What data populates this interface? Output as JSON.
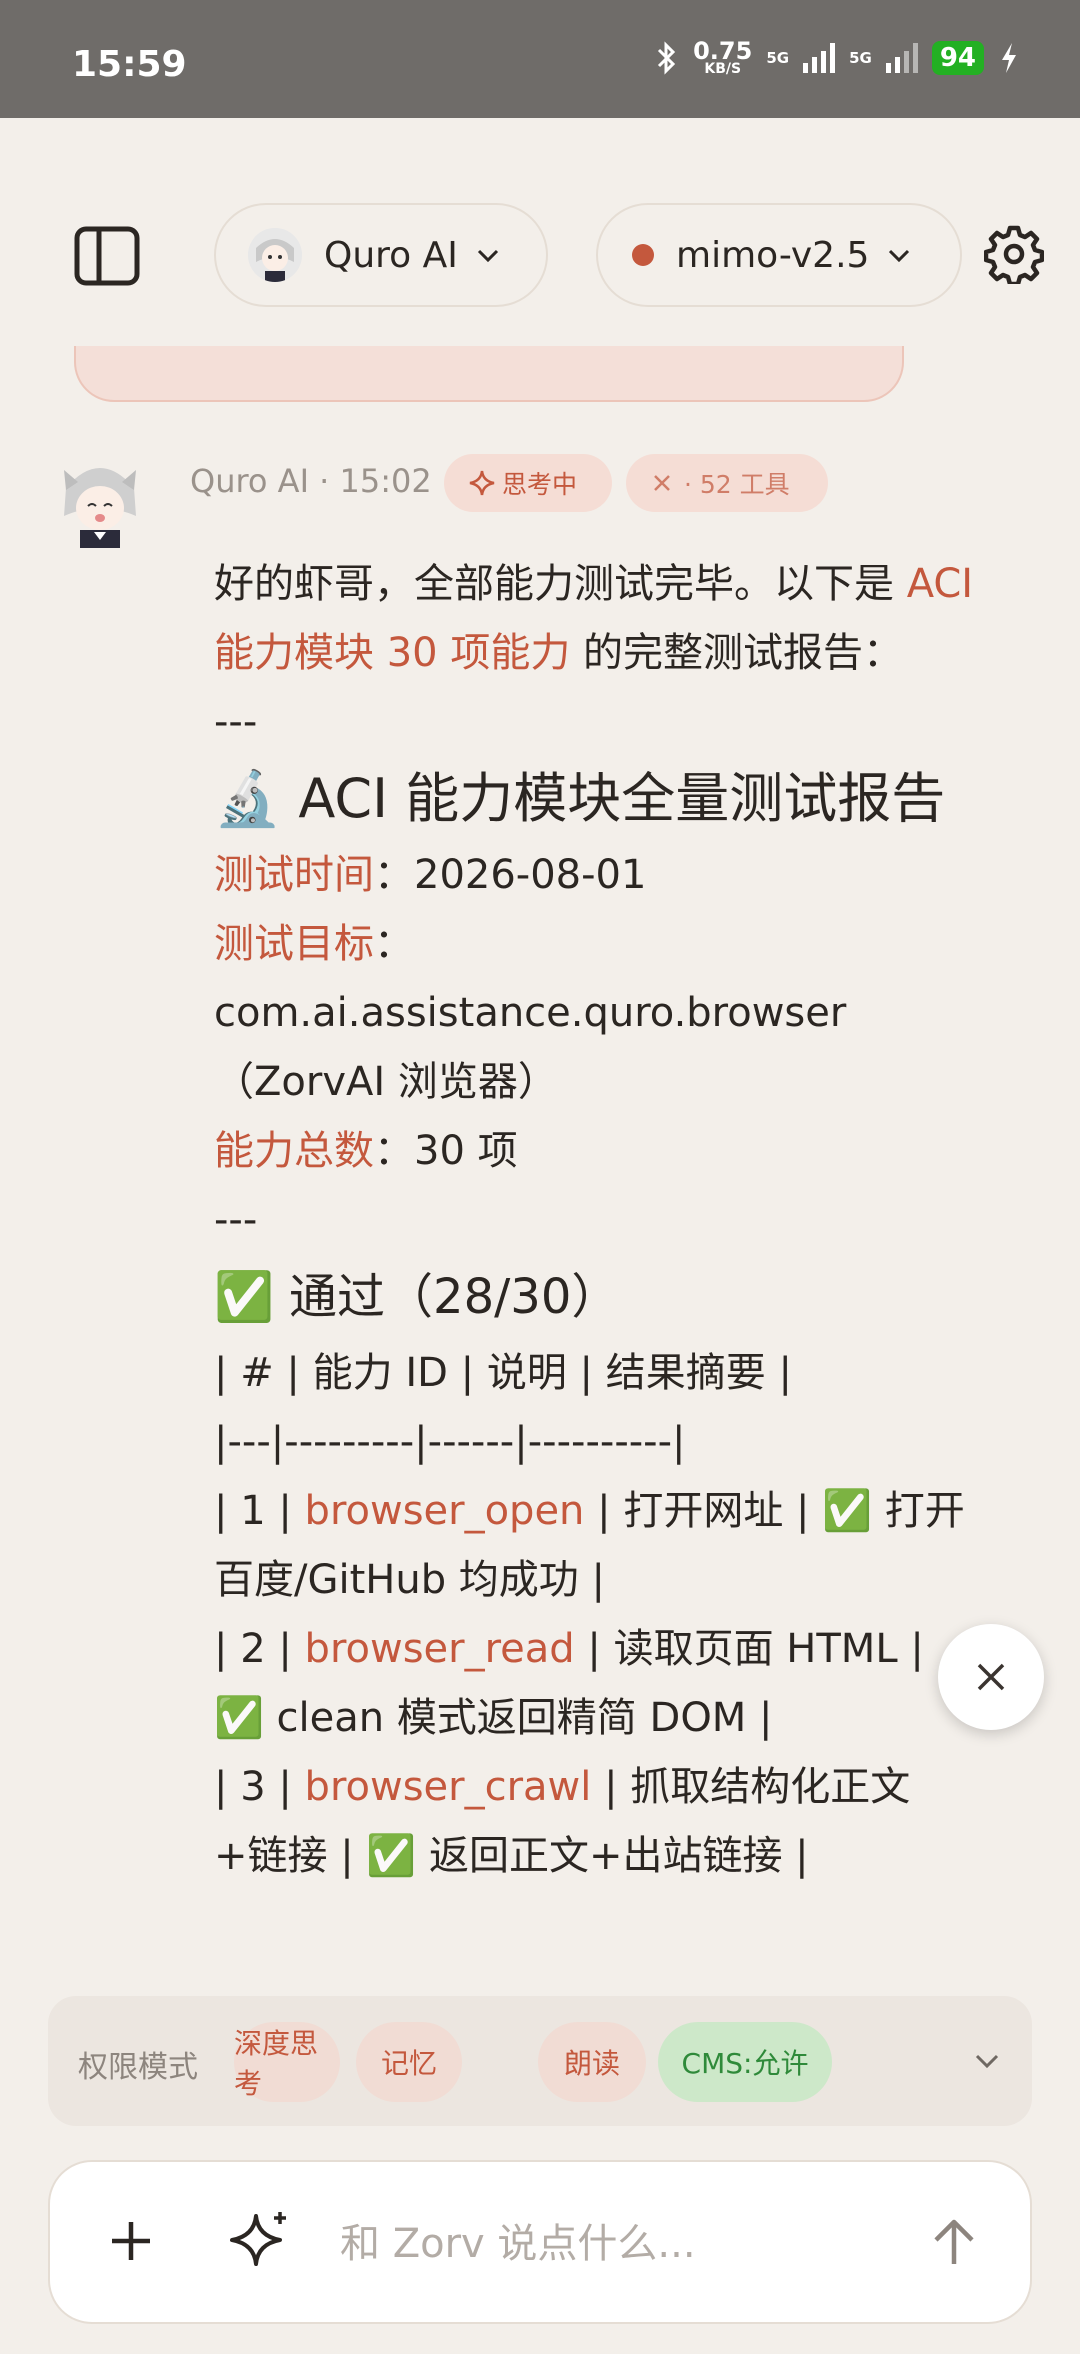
{
  "status_bar": {
    "time": "15:59",
    "net_speed_value": "0.75",
    "net_speed_unit": "KB/S",
    "sim1": "5G",
    "sim2": "5G",
    "battery": "94"
  },
  "header": {
    "agent_name": "Quro AI",
    "model_name": "mimo-v2.5",
    "model_status_color": "#c4583d"
  },
  "message": {
    "author": "Quro AI",
    "separator": " · ",
    "time": "15:02",
    "badge_thinking": "思考中",
    "badge_tools": "· 52 工具",
    "intro": "好的虾哥，全部能力测试完毕。以下是 ",
    "intro_highlight": "ACI 能力模块 30 项能力",
    "intro_tail": " 的完整测试报告：",
    "divider1": "---",
    "report_title": "🔬 ACI 能力模块全量测试报告",
    "test_time_label": "测试时间",
    "test_time_value": "：2026-08-01",
    "test_target_label": "测试目标",
    "test_target_value": "：com.ai.assistance.quro.browser（ZorvAI 浏览器）",
    "total_label": "能力总数",
    "total_value": "：30 项",
    "divider2": "---",
    "pass_title": "✅ 通过（28/30）",
    "table_header": "| # | 能力 ID | 说明 | 结果摘要 |",
    "table_sep": "|---|---------|------|----------|",
    "rows": [
      {
        "prefix": "| 1 | ",
        "id": "browser_open",
        "suffix": " | 打开网址 | ✅ 打开百度/GitHub 均成功 |"
      },
      {
        "prefix": "| 2 | ",
        "id": "browser_read",
        "suffix": " | 读取页面 HTML | ✅ clean 模式返回精简 DOM |"
      },
      {
        "prefix": "| 3 | ",
        "id": "browser_crawl",
        "suffix": " | 抓取结构化正文+链接 | ✅ 返回正文+出站链接 |"
      }
    ]
  },
  "mode_bar": {
    "label": "权限模式",
    "chips": [
      {
        "label": "深度思考",
        "active": false
      },
      {
        "label": "记忆",
        "active": false
      },
      {
        "label": "朗读",
        "active": false
      },
      {
        "label": "CMS:允许",
        "active": true
      }
    ]
  },
  "input": {
    "placeholder": "和 Zorv 说点什么...",
    "value": ""
  },
  "colors": {
    "accent": "#c4583d",
    "chip_active_bg": "#cde8c9",
    "chip_active_text": "#2f8a3a",
    "background": "#f3efea"
  }
}
